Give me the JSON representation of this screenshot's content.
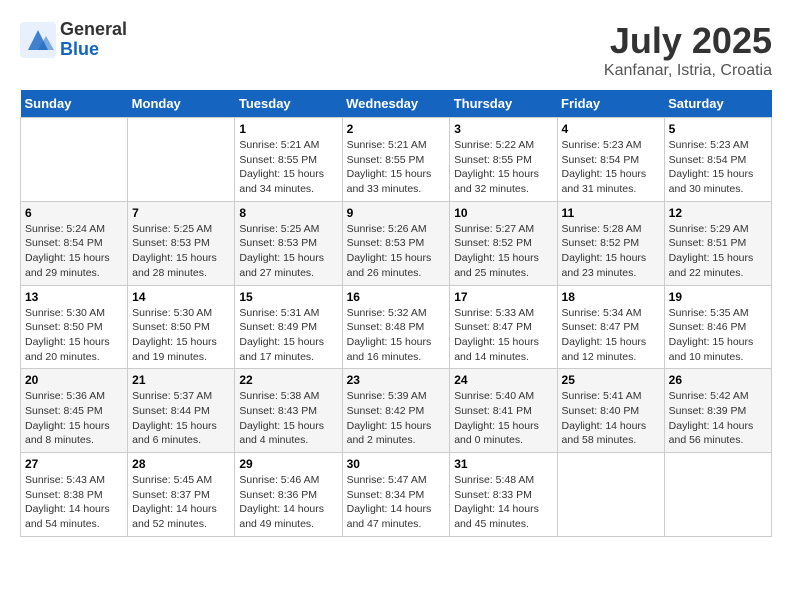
{
  "logo": {
    "general": "General",
    "blue": "Blue"
  },
  "title": {
    "month_year": "July 2025",
    "location": "Kanfanar, Istria, Croatia"
  },
  "days_of_week": [
    "Sunday",
    "Monday",
    "Tuesday",
    "Wednesday",
    "Thursday",
    "Friday",
    "Saturday"
  ],
  "weeks": [
    [
      {
        "day": "",
        "content": ""
      },
      {
        "day": "",
        "content": ""
      },
      {
        "day": "1",
        "content": "Sunrise: 5:21 AM\nSunset: 8:55 PM\nDaylight: 15 hours\nand 34 minutes."
      },
      {
        "day": "2",
        "content": "Sunrise: 5:21 AM\nSunset: 8:55 PM\nDaylight: 15 hours\nand 33 minutes."
      },
      {
        "day": "3",
        "content": "Sunrise: 5:22 AM\nSunset: 8:55 PM\nDaylight: 15 hours\nand 32 minutes."
      },
      {
        "day": "4",
        "content": "Sunrise: 5:23 AM\nSunset: 8:54 PM\nDaylight: 15 hours\nand 31 minutes."
      },
      {
        "day": "5",
        "content": "Sunrise: 5:23 AM\nSunset: 8:54 PM\nDaylight: 15 hours\nand 30 minutes."
      }
    ],
    [
      {
        "day": "6",
        "content": "Sunrise: 5:24 AM\nSunset: 8:54 PM\nDaylight: 15 hours\nand 29 minutes."
      },
      {
        "day": "7",
        "content": "Sunrise: 5:25 AM\nSunset: 8:53 PM\nDaylight: 15 hours\nand 28 minutes."
      },
      {
        "day": "8",
        "content": "Sunrise: 5:25 AM\nSunset: 8:53 PM\nDaylight: 15 hours\nand 27 minutes."
      },
      {
        "day": "9",
        "content": "Sunrise: 5:26 AM\nSunset: 8:53 PM\nDaylight: 15 hours\nand 26 minutes."
      },
      {
        "day": "10",
        "content": "Sunrise: 5:27 AM\nSunset: 8:52 PM\nDaylight: 15 hours\nand 25 minutes."
      },
      {
        "day": "11",
        "content": "Sunrise: 5:28 AM\nSunset: 8:52 PM\nDaylight: 15 hours\nand 23 minutes."
      },
      {
        "day": "12",
        "content": "Sunrise: 5:29 AM\nSunset: 8:51 PM\nDaylight: 15 hours\nand 22 minutes."
      }
    ],
    [
      {
        "day": "13",
        "content": "Sunrise: 5:30 AM\nSunset: 8:50 PM\nDaylight: 15 hours\nand 20 minutes."
      },
      {
        "day": "14",
        "content": "Sunrise: 5:30 AM\nSunset: 8:50 PM\nDaylight: 15 hours\nand 19 minutes."
      },
      {
        "day": "15",
        "content": "Sunrise: 5:31 AM\nSunset: 8:49 PM\nDaylight: 15 hours\nand 17 minutes."
      },
      {
        "day": "16",
        "content": "Sunrise: 5:32 AM\nSunset: 8:48 PM\nDaylight: 15 hours\nand 16 minutes."
      },
      {
        "day": "17",
        "content": "Sunrise: 5:33 AM\nSunset: 8:47 PM\nDaylight: 15 hours\nand 14 minutes."
      },
      {
        "day": "18",
        "content": "Sunrise: 5:34 AM\nSunset: 8:47 PM\nDaylight: 15 hours\nand 12 minutes."
      },
      {
        "day": "19",
        "content": "Sunrise: 5:35 AM\nSunset: 8:46 PM\nDaylight: 15 hours\nand 10 minutes."
      }
    ],
    [
      {
        "day": "20",
        "content": "Sunrise: 5:36 AM\nSunset: 8:45 PM\nDaylight: 15 hours\nand 8 minutes."
      },
      {
        "day": "21",
        "content": "Sunrise: 5:37 AM\nSunset: 8:44 PM\nDaylight: 15 hours\nand 6 minutes."
      },
      {
        "day": "22",
        "content": "Sunrise: 5:38 AM\nSunset: 8:43 PM\nDaylight: 15 hours\nand 4 minutes."
      },
      {
        "day": "23",
        "content": "Sunrise: 5:39 AM\nSunset: 8:42 PM\nDaylight: 15 hours\nand 2 minutes."
      },
      {
        "day": "24",
        "content": "Sunrise: 5:40 AM\nSunset: 8:41 PM\nDaylight: 15 hours\nand 0 minutes."
      },
      {
        "day": "25",
        "content": "Sunrise: 5:41 AM\nSunset: 8:40 PM\nDaylight: 14 hours\nand 58 minutes."
      },
      {
        "day": "26",
        "content": "Sunrise: 5:42 AM\nSunset: 8:39 PM\nDaylight: 14 hours\nand 56 minutes."
      }
    ],
    [
      {
        "day": "27",
        "content": "Sunrise: 5:43 AM\nSunset: 8:38 PM\nDaylight: 14 hours\nand 54 minutes."
      },
      {
        "day": "28",
        "content": "Sunrise: 5:45 AM\nSunset: 8:37 PM\nDaylight: 14 hours\nand 52 minutes."
      },
      {
        "day": "29",
        "content": "Sunrise: 5:46 AM\nSunset: 8:36 PM\nDaylight: 14 hours\nand 49 minutes."
      },
      {
        "day": "30",
        "content": "Sunrise: 5:47 AM\nSunset: 8:34 PM\nDaylight: 14 hours\nand 47 minutes."
      },
      {
        "day": "31",
        "content": "Sunrise: 5:48 AM\nSunset: 8:33 PM\nDaylight: 14 hours\nand 45 minutes."
      },
      {
        "day": "",
        "content": ""
      },
      {
        "day": "",
        "content": ""
      }
    ]
  ]
}
